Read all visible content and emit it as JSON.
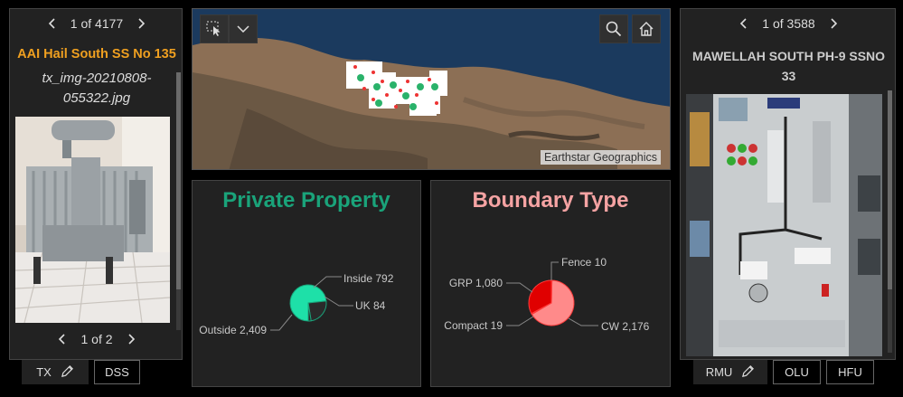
{
  "left_panel": {
    "pager_text": "1 of 4177",
    "title": "AAI Hail South SS No 135",
    "filename": "tx_img-20210808-055322.jpg",
    "photo_pager_text": "1 of 2",
    "tabs": [
      "TX",
      "DSS"
    ],
    "title_color": "#f0a020"
  },
  "map": {
    "attribution": "Earthstar Geographics"
  },
  "private_property": {
    "title": "Private Property",
    "title_color": "#1aa37a"
  },
  "boundary_type": {
    "title": "Boundary Type",
    "title_color": "#f5a3a3"
  },
  "right_panel": {
    "pager_text": "1 of 3588",
    "title": "MAWELLAH SOUTH PH-9 SSNO 33",
    "tabs": [
      "RMU",
      "OLU",
      "HFU"
    ]
  },
  "chart_data": [
    {
      "type": "pie",
      "title": "Private Property",
      "categories": [
        "Outside",
        "Inside",
        "UK"
      ],
      "values": [
        2409,
        792,
        84
      ],
      "labels": [
        "Outside 2,409",
        "Inside 792",
        "UK 84"
      ],
      "colors": [
        "#1ee0a8",
        "#2a2a2a",
        "#2a2a2a"
      ]
    },
    {
      "type": "pie",
      "title": "Boundary Type",
      "categories": [
        "CW",
        "Compact",
        "GRP",
        "Fence"
      ],
      "values": [
        2176,
        19,
        1080,
        10
      ],
      "labels": [
        "CW 2,176",
        "Compact 19",
        "GRP 1,080",
        "Fence 10"
      ],
      "colors": [
        "#ff8a8a",
        "#ff5050",
        "#e00000",
        "#ff9e9e"
      ]
    }
  ]
}
